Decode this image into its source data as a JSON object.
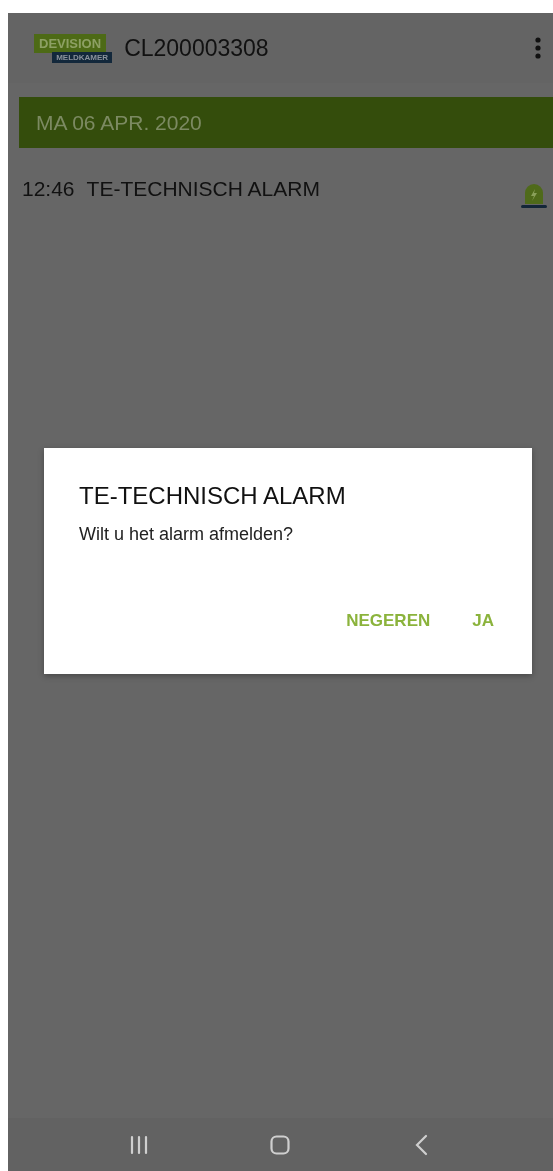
{
  "app_bar": {
    "logo_top": "DEVISION",
    "logo_bottom": "MELDKAMER",
    "title": "CL200003308"
  },
  "date_header": "MA 06 APR. 2020",
  "alarms": [
    {
      "time": "12:46",
      "label": "TE-TECHNISCH ALARM"
    }
  ],
  "dialog": {
    "title": "TE-TECHNISCH ALARM",
    "message": "Wilt u het alarm afmelden?",
    "buttons": [
      "NEGEREN",
      "JA"
    ]
  }
}
